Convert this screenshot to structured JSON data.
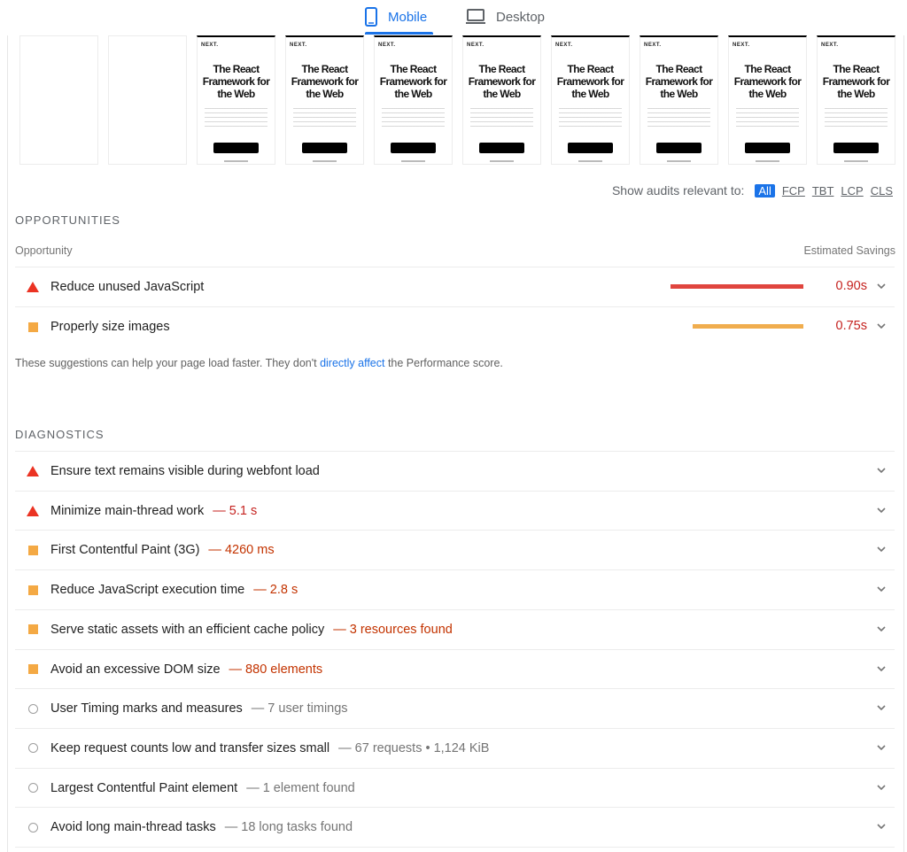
{
  "tabs": {
    "mobile_label": "Mobile",
    "desktop_label": "Desktop",
    "active": "mobile",
    "accent_color": "#1a73e8"
  },
  "filmstrip": {
    "frames": [
      {
        "state": "blank"
      },
      {
        "state": "blank"
      },
      {
        "state": "rendered",
        "logo": "NEXT.",
        "headline": "The React Framework for the Web"
      },
      {
        "state": "rendered",
        "logo": "NEXT.",
        "headline": "The React Framework for the Web"
      },
      {
        "state": "rendered",
        "logo": "NEXT.",
        "headline": "The React Framework for the Web"
      },
      {
        "state": "rendered",
        "logo": "NEXT.",
        "headline": "The React Framework for the Web"
      },
      {
        "state": "rendered",
        "logo": "NEXT.",
        "headline": "The React Framework for the Web"
      },
      {
        "state": "rendered",
        "logo": "NEXT.",
        "headline": "The React Framework for the Web"
      },
      {
        "state": "rendered",
        "logo": "NEXT.",
        "headline": "The React Framework for the Web"
      },
      {
        "state": "rendered",
        "logo": "NEXT.",
        "headline": "The React Framework for the Web"
      }
    ]
  },
  "filter": {
    "label": "Show audits relevant to:",
    "options": [
      "All",
      "FCP",
      "TBT",
      "LCP",
      "CLS"
    ],
    "active": "All"
  },
  "opportunities": {
    "title": "OPPORTUNITIES",
    "col_left": "Opportunity",
    "col_right": "Estimated Savings",
    "items": [
      {
        "severity": "fail",
        "title": "Reduce unused JavaScript",
        "savings": "0.90s",
        "savings_seconds": 0.9,
        "bar_color": "#e0453e"
      },
      {
        "severity": "average",
        "title": "Properly size images",
        "savings": "0.75s",
        "savings_seconds": 0.75,
        "bar_color": "#f0ad4e"
      }
    ],
    "note_before": "These suggestions can help your page load faster. They don't ",
    "note_link": "directly affect",
    "note_after": " the Performance score."
  },
  "diagnostics": {
    "title": "DIAGNOSTICS",
    "items": [
      {
        "severity": "fail",
        "title": "Ensure text remains visible during webfont load",
        "display": ""
      },
      {
        "severity": "fail",
        "title": "Minimize main-thread work",
        "display": "— 5.1 s"
      },
      {
        "severity": "average",
        "title": "First Contentful Paint (3G)",
        "display": "— 4260 ms"
      },
      {
        "severity": "average",
        "title": "Reduce JavaScript execution time",
        "display": "— 2.8 s"
      },
      {
        "severity": "average",
        "title": "Serve static assets with an efficient cache policy",
        "display": "— 3 resources found"
      },
      {
        "severity": "average",
        "title": "Avoid an excessive DOM size",
        "display": "— 880 elements"
      },
      {
        "severity": "info",
        "title": "User Timing marks and measures",
        "display": "— 7 user timings"
      },
      {
        "severity": "info",
        "title": "Keep request counts low and transfer sizes small",
        "display": "— 67 requests • 1,124 KiB"
      },
      {
        "severity": "info",
        "title": "Largest Contentful Paint element",
        "display": "— 1 element found"
      },
      {
        "severity": "info",
        "title": "Avoid long main-thread tasks",
        "display": "— 18 long tasks found"
      }
    ]
  },
  "colors": {
    "fail": "#eb3323",
    "average": "#f4a944",
    "info": "#9e9e9e"
  }
}
